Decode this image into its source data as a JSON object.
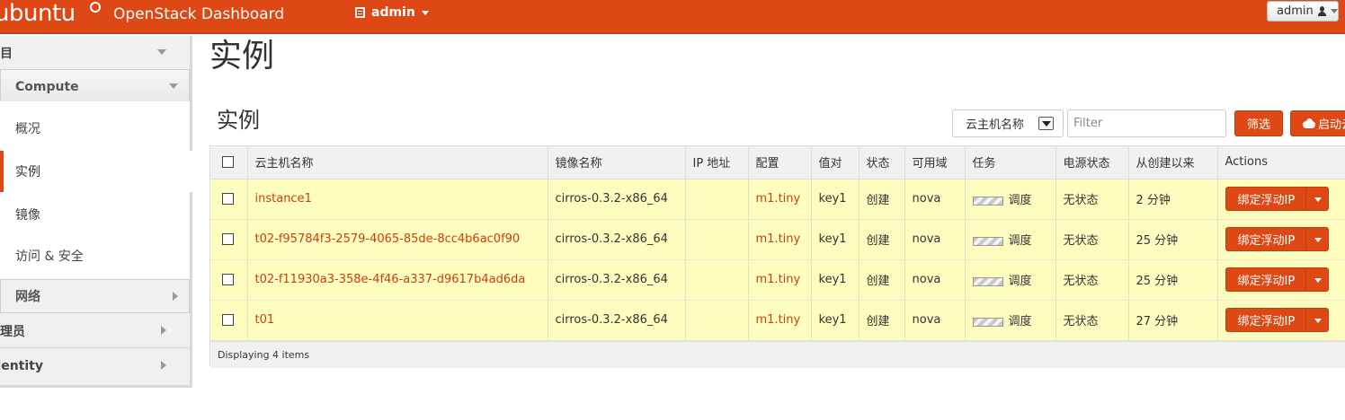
{
  "header": {
    "brand": "ubuntu",
    "dashboard_title": "OpenStack Dashboard",
    "project": "admin",
    "user": "admin"
  },
  "sidebar": {
    "project_label": "项目",
    "compute_label": "Compute",
    "items": [
      {
        "label": "概况",
        "active": false
      },
      {
        "label": "实例",
        "active": true
      },
      {
        "label": "镜像",
        "active": false
      },
      {
        "label": "访问 & 安全",
        "active": false
      }
    ],
    "network_label": "网络",
    "admin_label": "管理员",
    "identity_label": "Identity"
  },
  "main": {
    "page_title": "实例",
    "section_title": "实例",
    "filter": {
      "select_value": "云主机名称",
      "placeholder": "Filter",
      "filter_button": "筛选",
      "launch_button": "启动云主机"
    },
    "table": {
      "columns": [
        "云主机名称",
        "镜像名称",
        "IP 地址",
        "配置",
        "值对",
        "状态",
        "可用域",
        "任务",
        "电源状态",
        "从创建以来",
        "Actions"
      ],
      "rows": [
        {
          "name": "instance1",
          "image": "cirros-0.3.2-x86_64",
          "ip": "",
          "flavor": "m1.tiny",
          "keypair": "key1",
          "status": "创建",
          "zone": "nova",
          "task": "调度",
          "power": "无状态",
          "age": "2 分钟",
          "action": "绑定浮动IP"
        },
        {
          "name": "t02-f95784f3-2579-4065-85de-8cc4b6ac0f90",
          "image": "cirros-0.3.2-x86_64",
          "ip": "",
          "flavor": "m1.tiny",
          "keypair": "key1",
          "status": "创建",
          "zone": "nova",
          "task": "调度",
          "power": "无状态",
          "age": "25 分钟",
          "action": "绑定浮动IP"
        },
        {
          "name": "t02-f11930a3-358e-4f46-a337-d9617b4ad6da",
          "image": "cirros-0.3.2-x86_64",
          "ip": "",
          "flavor": "m1.tiny",
          "keypair": "key1",
          "status": "创建",
          "zone": "nova",
          "task": "调度",
          "power": "无状态",
          "age": "25 分钟",
          "action": "绑定浮动IP"
        },
        {
          "name": "t01",
          "image": "cirros-0.3.2-x86_64",
          "ip": "",
          "flavor": "m1.tiny",
          "keypair": "key1",
          "status": "创建",
          "zone": "nova",
          "task": "调度",
          "power": "无状态",
          "age": "27 分钟",
          "action": "绑定浮动IP"
        }
      ],
      "footer": "Displaying 4 items"
    }
  },
  "colors": {
    "accent": "#dd4814",
    "row_highlight": "#fdfdc0",
    "link": "#c9400f"
  }
}
